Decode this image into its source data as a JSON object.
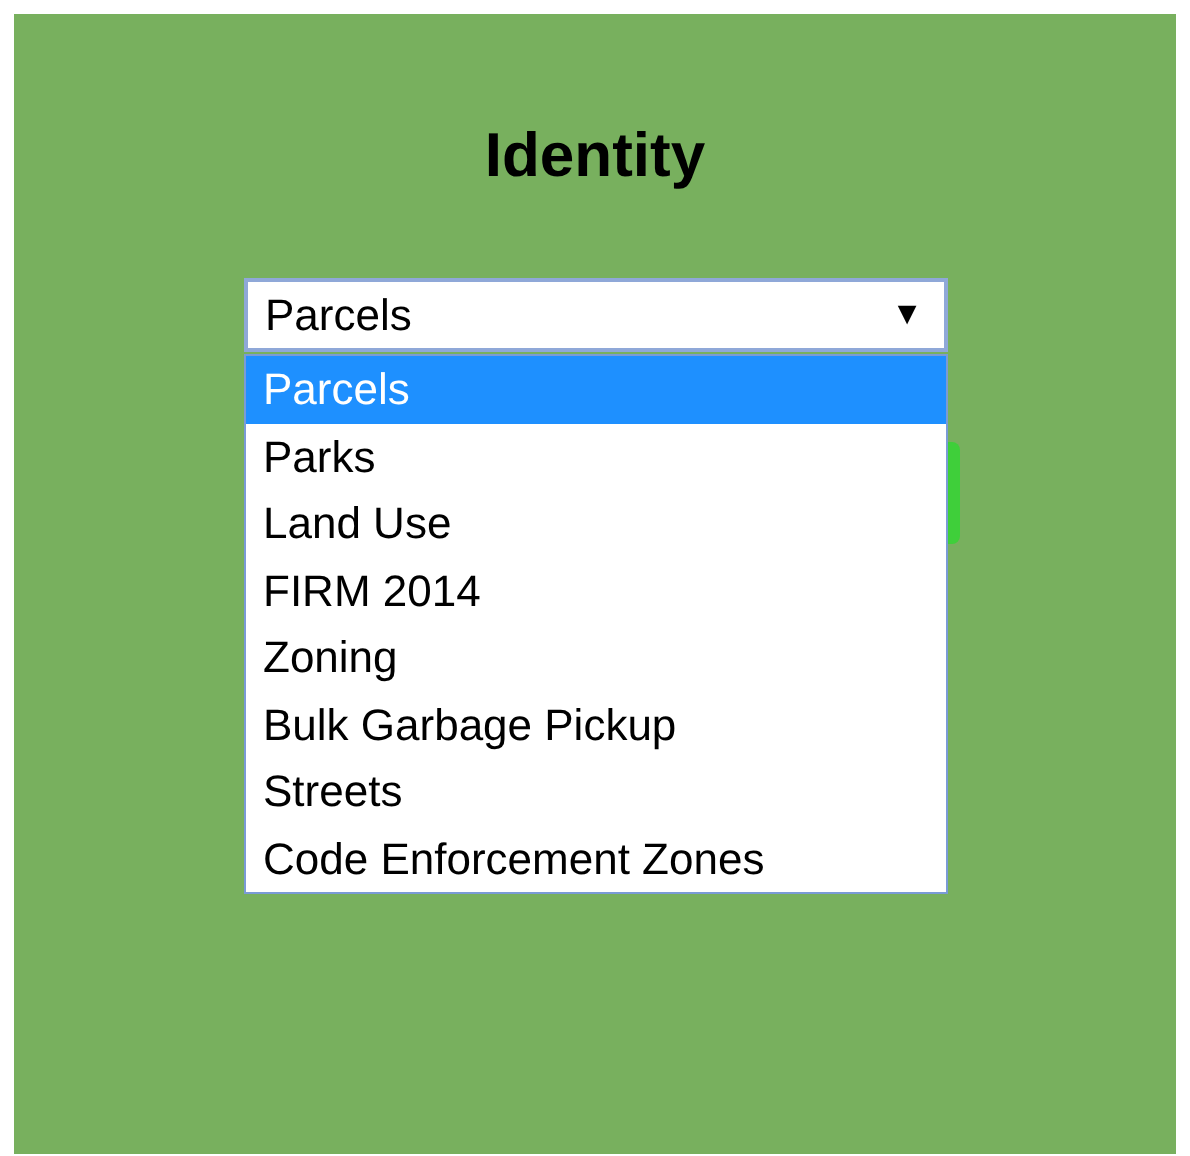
{
  "title": "Identity",
  "select": {
    "value": "Parcels",
    "arrow": "▼",
    "expanded": true,
    "options": [
      {
        "label": "Parcels",
        "selected": true
      },
      {
        "label": "Parks",
        "selected": false
      },
      {
        "label": "Land Use",
        "selected": false
      },
      {
        "label": "FIRM 2014",
        "selected": false
      },
      {
        "label": "Zoning",
        "selected": false
      },
      {
        "label": "Bulk Garbage Pickup",
        "selected": false
      },
      {
        "label": "Streets",
        "selected": false
      },
      {
        "label": "Code Enforcement Zones",
        "selected": false
      }
    ]
  }
}
